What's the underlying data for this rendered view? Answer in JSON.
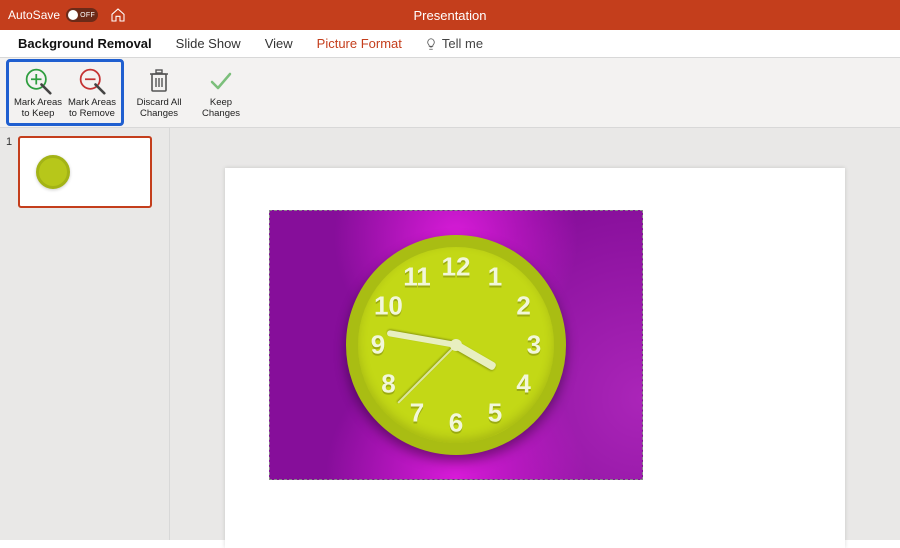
{
  "titlebar": {
    "autosave_label": "AutoSave",
    "autosave_state": "OFF",
    "doc_title": "Presentation"
  },
  "menubar": {
    "tabs": [
      {
        "label": "Background Removal",
        "style": "bold"
      },
      {
        "label": "Slide Show",
        "style": ""
      },
      {
        "label": "View",
        "style": ""
      },
      {
        "label": "Picture Format",
        "style": "orange"
      }
    ],
    "tell_me": "Tell me"
  },
  "ribbon": {
    "mark_keep": {
      "line1": "Mark Areas",
      "line2": "to Keep"
    },
    "mark_remove": {
      "line1": "Mark Areas",
      "line2": "to Remove"
    },
    "discard": {
      "line1": "Discard All",
      "line2": "Changes"
    },
    "keep": {
      "line1": "Keep",
      "line2": "Changes"
    }
  },
  "thumbnails": {
    "slide1_number": "1"
  },
  "clock": {
    "numbers": [
      "12",
      "1",
      "2",
      "3",
      "4",
      "5",
      "6",
      "7",
      "8",
      "9",
      "10",
      "11"
    ],
    "hour_angle": 120,
    "minute_angle": 280,
    "second_angle": 225
  },
  "colors": {
    "brand": "#C43E1C",
    "highlight": "#1f5fd0",
    "bg_removal": "#860e9a",
    "clock_face": "#c3d816"
  }
}
